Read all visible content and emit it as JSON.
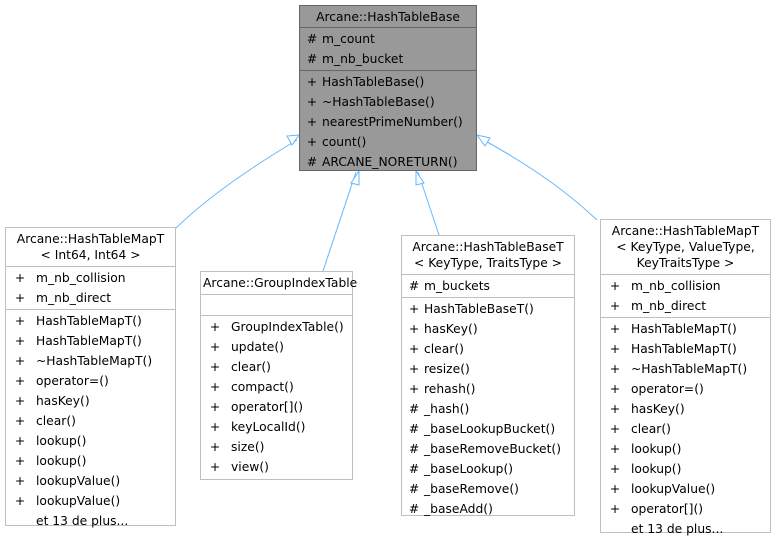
{
  "diagram": {
    "edge_color": "#63b8ff",
    "base_fill": "#999999",
    "base_class": {
      "title_lines": [
        "Arcane::HashTableBase"
      ],
      "fields": [
        {
          "vis": "#",
          "name": "m_count"
        },
        {
          "vis": "#",
          "name": "m_nb_bucket"
        }
      ],
      "methods": [
        {
          "vis": "+",
          "name": "HashTableBase()"
        },
        {
          "vis": "+",
          "name": "~HashTableBase()"
        },
        {
          "vis": "+",
          "name": "nearestPrimeNumber()"
        },
        {
          "vis": "+",
          "name": "count()"
        },
        {
          "vis": "#",
          "name": "ARCANE_NORETURN()"
        }
      ]
    },
    "derived_classes": [
      {
        "title_lines": [
          "Arcane::HashTableMapT",
          "< Int64, Int64 >"
        ],
        "fields": [
          {
            "vis": "+",
            "name": "m_nb_collision"
          },
          {
            "vis": "+",
            "name": "m_nb_direct"
          }
        ],
        "methods": [
          {
            "vis": "+",
            "name": "HashTableMapT()"
          },
          {
            "vis": "+",
            "name": "HashTableMapT()"
          },
          {
            "vis": "+",
            "name": "~HashTableMapT()"
          },
          {
            "vis": "+",
            "name": "operator=()"
          },
          {
            "vis": "+",
            "name": "hasKey()"
          },
          {
            "vis": "+",
            "name": "clear()"
          },
          {
            "vis": "+",
            "name": "lookup()"
          },
          {
            "vis": "+",
            "name": "lookup()"
          },
          {
            "vis": "+",
            "name": "lookupValue()"
          },
          {
            "vis": "+",
            "name": "lookupValue()"
          },
          {
            "vis": "",
            "name": "et 13 de plus..."
          }
        ]
      },
      {
        "title_lines": [
          "Arcane::GroupIndexTable"
        ],
        "fields": [],
        "methods": [
          {
            "vis": "+",
            "name": "GroupIndexTable()"
          },
          {
            "vis": "+",
            "name": "update()"
          },
          {
            "vis": "+",
            "name": "clear()"
          },
          {
            "vis": "+",
            "name": "compact()"
          },
          {
            "vis": "+",
            "name": "operator[]()"
          },
          {
            "vis": "+",
            "name": "keyLocalId()"
          },
          {
            "vis": "+",
            "name": "size()"
          },
          {
            "vis": "+",
            "name": "view()"
          }
        ]
      },
      {
        "title_lines": [
          "Arcane::HashTableBaseT",
          "< KeyType, TraitsType >"
        ],
        "fields": [
          {
            "vis": "#",
            "name": "m_buckets"
          }
        ],
        "methods": [
          {
            "vis": "+",
            "name": "HashTableBaseT()"
          },
          {
            "vis": "+",
            "name": "hasKey()"
          },
          {
            "vis": "+",
            "name": "clear()"
          },
          {
            "vis": "+",
            "name": "resize()"
          },
          {
            "vis": "+",
            "name": "rehash()"
          },
          {
            "vis": "#",
            "name": "_hash()"
          },
          {
            "vis": "#",
            "name": "_baseLookupBucket()"
          },
          {
            "vis": "#",
            "name": "_baseRemoveBucket()"
          },
          {
            "vis": "#",
            "name": "_baseLookup()"
          },
          {
            "vis": "#",
            "name": "_baseRemove()"
          },
          {
            "vis": "#",
            "name": "_baseAdd()"
          }
        ]
      },
      {
        "title_lines": [
          "Arcane::HashTableMapT",
          "< KeyType, ValueType,",
          "KeyTraitsType >"
        ],
        "fields": [
          {
            "vis": "+",
            "name": "m_nb_collision"
          },
          {
            "vis": "+",
            "name": "m_nb_direct"
          }
        ],
        "methods": [
          {
            "vis": "+",
            "name": "HashTableMapT()"
          },
          {
            "vis": "+",
            "name": "HashTableMapT()"
          },
          {
            "vis": "+",
            "name": "~HashTableMapT()"
          },
          {
            "vis": "+",
            "name": "operator=()"
          },
          {
            "vis": "+",
            "name": "hasKey()"
          },
          {
            "vis": "+",
            "name": "clear()"
          },
          {
            "vis": "+",
            "name": "lookup()"
          },
          {
            "vis": "+",
            "name": "lookup()"
          },
          {
            "vis": "+",
            "name": "lookupValue()"
          },
          {
            "vis": "+",
            "name": "operator[]()"
          },
          {
            "vis": "",
            "name": "et 13 de plus..."
          }
        ]
      }
    ]
  }
}
